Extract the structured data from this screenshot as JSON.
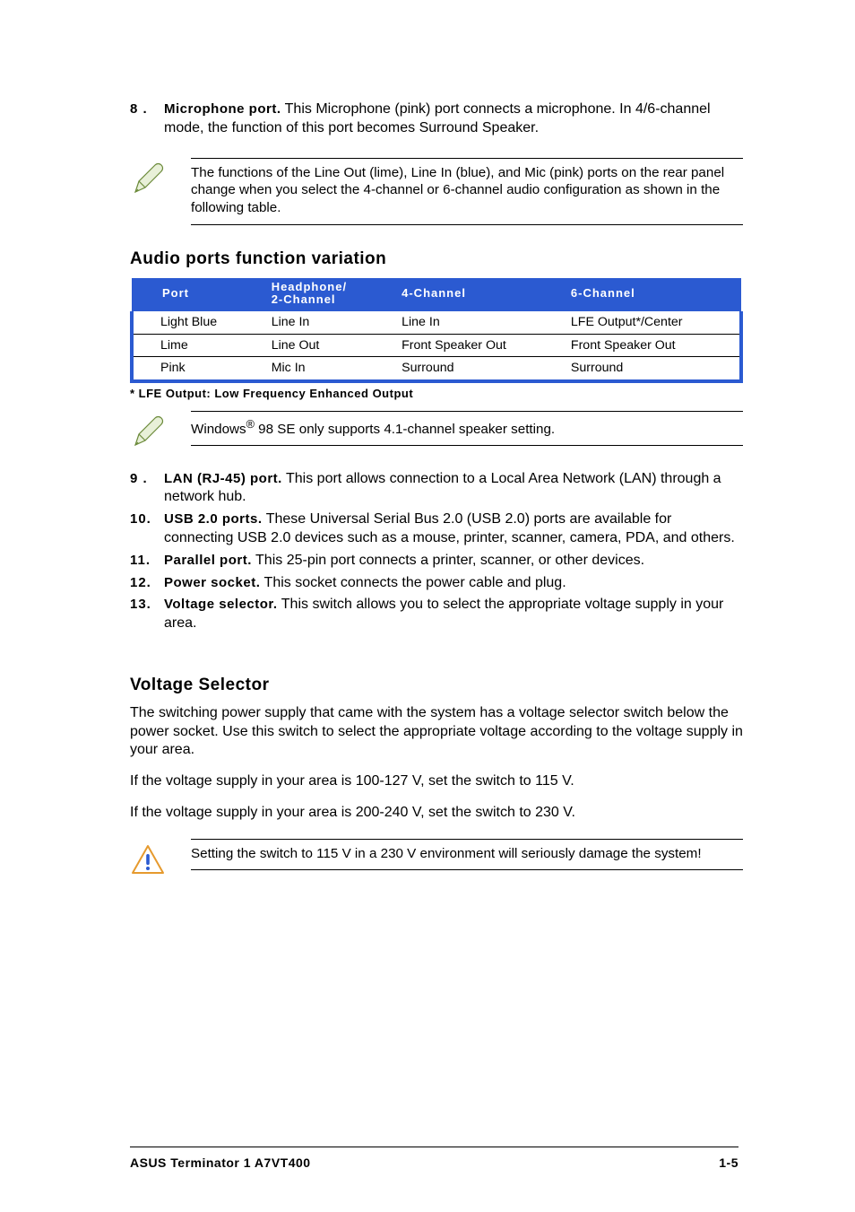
{
  "items": {
    "i8": {
      "num": "8 .",
      "title": "Microphone port.",
      "body": " This Microphone (pink) port connects a microphone. In 4/6-channel mode, the function of this port becomes Surround Speaker."
    },
    "i9": {
      "num": "9 .",
      "title": "LAN (RJ-45) port.",
      "body": " This port allows connection to a Local Area Network (LAN) through a network hub."
    },
    "i10": {
      "num": "10.",
      "title": "USB 2.0 ports.",
      "body": " These Universal Serial Bus 2.0 (USB 2.0) ports are available for connecting USB 2.0 devices such as a mouse, printer, scanner, camera, PDA, and others."
    },
    "i11": {
      "num": "11.",
      "title": "Parallel port.",
      "body": " This 25-pin port connects a printer, scanner, or other devices."
    },
    "i12": {
      "num": "12.",
      "title": "Power socket.",
      "body": " This socket connects the power cable and plug."
    },
    "i13": {
      "num": "13.",
      "title": "Voltage selector.",
      "body": " This switch allows you to select the appropriate voltage supply in your area."
    }
  },
  "notes": {
    "n1": "The functions of the Line Out (lime), Line In (blue), and Mic (pink) ports on the rear panel change when you select the 4-channel or 6-channel audio configuration as shown in the following table.",
    "n2_pre": "Windows",
    "n2_post": " 98 SE only supports 4.1-channel speaker setting.",
    "n3": "Setting the switch to 115 V in a 230 V environment will seriously damage the system!"
  },
  "headings": {
    "audio": "Audio ports function variation",
    "voltage": "Voltage Selector"
  },
  "table": {
    "headers": {
      "c1": "Port",
      "c2a": "Headphone/",
      "c2b": "2-Channel",
      "c3": "4-Channel",
      "c4": "6-Channel"
    },
    "rows": [
      {
        "c1": "Light Blue",
        "c2": "Line In",
        "c3": "Line In",
        "c4": "LFE Output*/Center"
      },
      {
        "c1": "Lime",
        "c2": "Line Out",
        "c3": "Front Speaker Out",
        "c4": "Front Speaker Out"
      },
      {
        "c1": "Pink",
        "c2": "Mic In",
        "c3": "Surround",
        "c4": "Surround"
      }
    ]
  },
  "footnote": "* LFE Output: Low Frequency Enhanced Output",
  "voltage": {
    "p1": "The switching power supply that came with the system has a voltage selector switch below the power socket. Use this switch to select the appropriate voltage according to the voltage supply in your area.",
    "p2": "If the voltage supply in your area is 100-127 V, set the switch to 115 V.",
    "p3": "If the voltage supply in your area is 200-240 V, set the switch to 230 V."
  },
  "footer": {
    "left": "ASUS Terminator 1 A7VT400",
    "right": "1-5"
  }
}
